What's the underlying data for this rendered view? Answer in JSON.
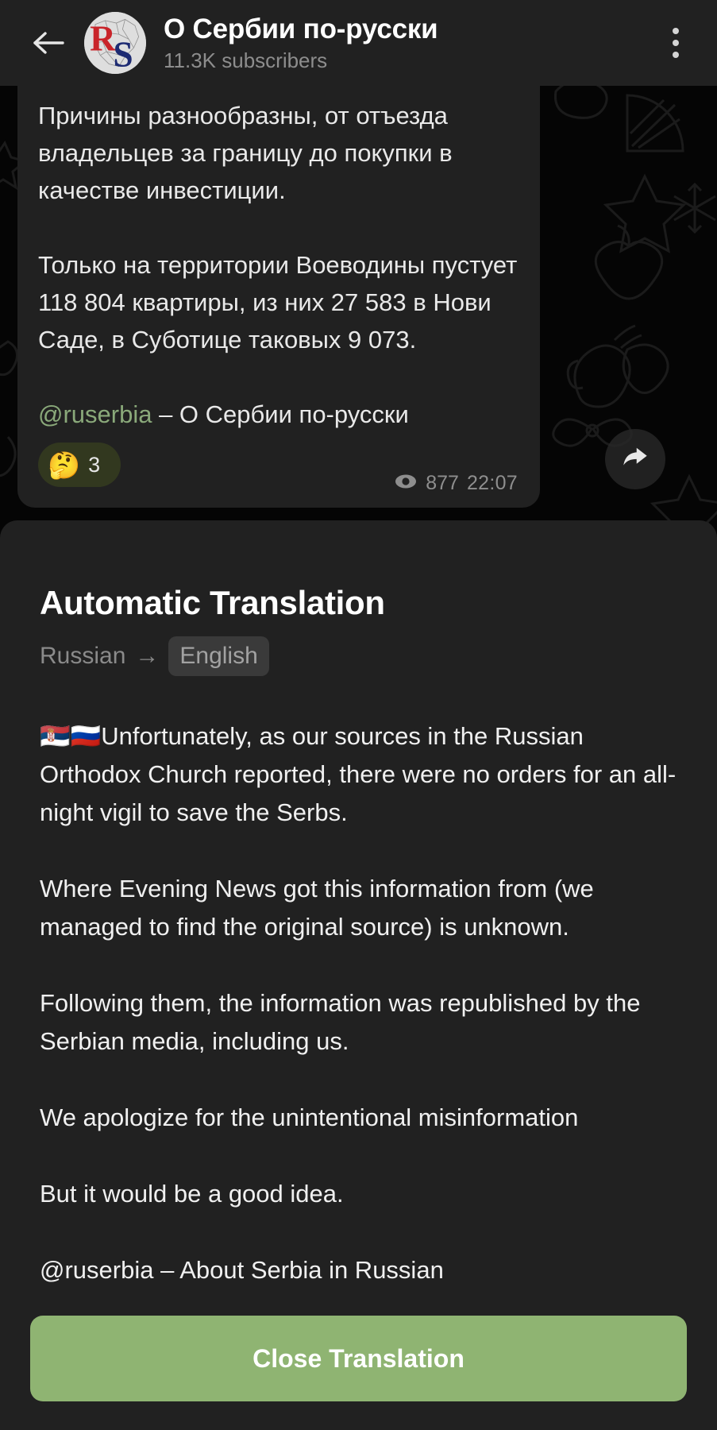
{
  "header": {
    "back_icon": "back-arrow-icon",
    "avatar_icon": "channel-avatar-serbia-map",
    "title": "О Сербии по-русски",
    "subtitle": "11.3K subscribers",
    "menu_icon": "more-options-icon"
  },
  "message": {
    "text_part_1": "Причины разнообразны, от отъезда владельцев за границу до покупки в качестве инвестиции.\n\nТолько на территории Воеводины пустует 118 804 квартиры, из них 27 583 в Нови Саде, в Суботице таковых 9 073.\n\n",
    "mention": "@ruserbia",
    "text_part_2": " – О Сербии по-русски",
    "reaction_emoji": "🤔",
    "reaction_count": "3",
    "views_icon": "eye-icon",
    "views": "877",
    "time": "22:07",
    "forward_icon": "forward-arrow-icon"
  },
  "translation": {
    "title": "Automatic Translation",
    "source_language": "Russian",
    "arrow": "→",
    "target_language": "English",
    "body": "🇷🇸🇷🇺Unfortunately, as our sources in the Russian Orthodox Church reported, there were no orders for an all-night vigil to save the Serbs.\n\nWhere Evening News got this information from (we managed to find the original source) is unknown.\n\nFollowing them, the information was republished by the Serbian media, including us.\n\nWe apologize for the unintentional misinformation\n\nBut it would be a good idea.\n\n@ruserbia – About Serbia in Russian",
    "close_label": "Close Translation"
  },
  "colors": {
    "accent_button": "#8fb472",
    "panel_background": "#212121",
    "mention_link": "#8aa97a",
    "chat_background": "#050505"
  }
}
